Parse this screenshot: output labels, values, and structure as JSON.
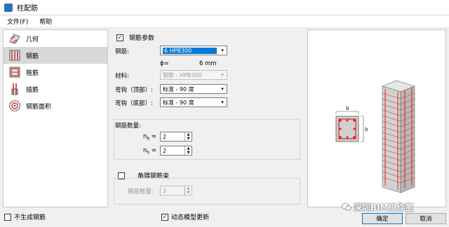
{
  "window": {
    "title": "柱配筋"
  },
  "menu": {
    "file": "文件(F)",
    "help": "帮助"
  },
  "sidebar": {
    "items": [
      {
        "label": "几何",
        "icon": "geometry-icon"
      },
      {
        "label": "钢筋",
        "icon": "rebar-icon",
        "active": true
      },
      {
        "label": "箍筋",
        "icon": "stirrup-icon"
      },
      {
        "label": "插筋",
        "icon": "dowel-icon"
      },
      {
        "label": "钢筋面积",
        "icon": "rebar-area-icon"
      }
    ]
  },
  "rebar_params": {
    "checked": true,
    "heading": "钢筋参数",
    "rebar_label": "钢筋:",
    "rebar_value": "6 HPB300",
    "phi_label": "ϕ=",
    "phi_value": "6 mm",
    "material_label": "材料:",
    "material_value": "钢筋 - HPB300",
    "hook_top_label": "弯钩（顶部）:",
    "hook_top_value": "标准 - 90 度",
    "hook_bottom_label": "弯钩（底部）:",
    "hook_bottom_value": "标准 - 90 度"
  },
  "rebar_count": {
    "heading": "钢筋数量:",
    "nb_label": "n",
    "nb_sub": "b",
    "nb_value": "2",
    "nh_label": "n",
    "nh_sub": "h",
    "nh_value": "2"
  },
  "corner_bundle": {
    "checked": false,
    "heading": "角隅钢筋束",
    "count_label": "钢筋数量:",
    "count_value": "2"
  },
  "preview": {
    "label_b": "b",
    "label_h": "h"
  },
  "footer": {
    "no_generate_label": "不生成钢筋",
    "no_generate_checked": false,
    "dynamic_update_label": "动态模型更新",
    "dynamic_update_checked": true,
    "ok_label": "确定",
    "cancel_label": "取消"
  },
  "watermark": {
    "text": "深圳BIM工作室"
  },
  "colors": {
    "accent": "#0078d7",
    "rebar": "#e02020",
    "concrete": "#c8c8c8"
  }
}
